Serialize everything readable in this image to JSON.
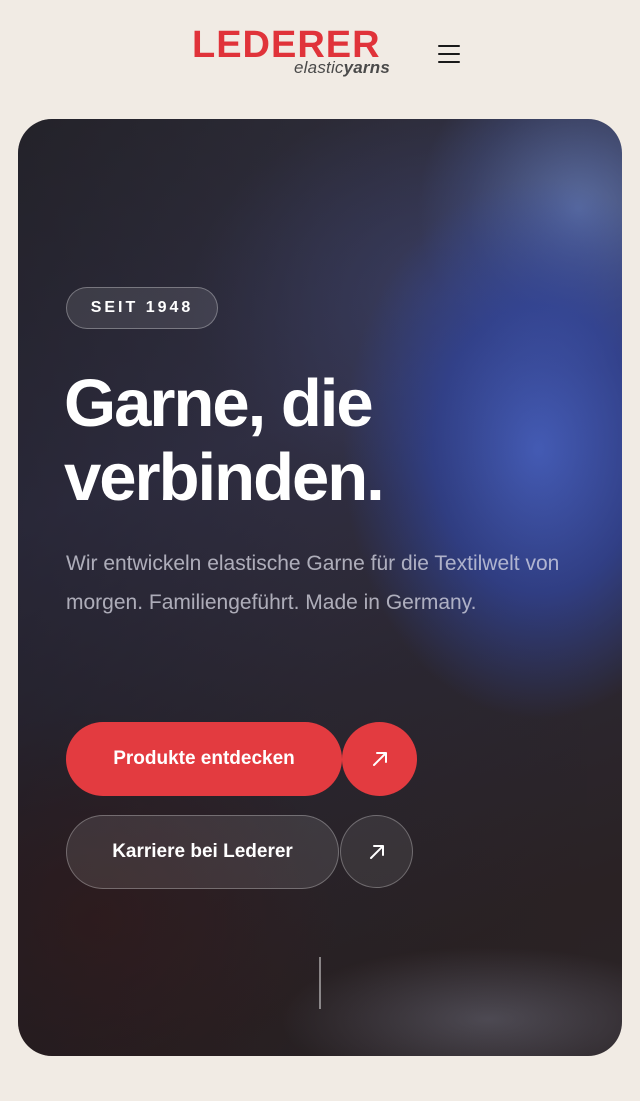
{
  "header": {
    "logo": {
      "wordmark": "LEDERER",
      "sub_light": "elastic",
      "sub_bold": "yarns"
    },
    "menu_icon": "hamburger-menu-icon"
  },
  "hero": {
    "badge": "SEIT 1948",
    "headline": "Garne, die\nverbinden.",
    "lead": "Wir entwickeln elastische Garne für die Textilwelt von morgen. Familiengeführt. Made in Germany.",
    "primary_button": {
      "label": "Produkte entdecken",
      "icon": "arrow-up-right-icon"
    },
    "secondary_button": {
      "label": "Karriere bei Lederer",
      "icon": "arrow-up-right-icon"
    },
    "scroll_indicator": "scroll-line"
  },
  "colors": {
    "background": "#f1ebe4",
    "brand_red": "#e0333a",
    "button_red": "#e33b40",
    "text_white": "#ffffff"
  }
}
